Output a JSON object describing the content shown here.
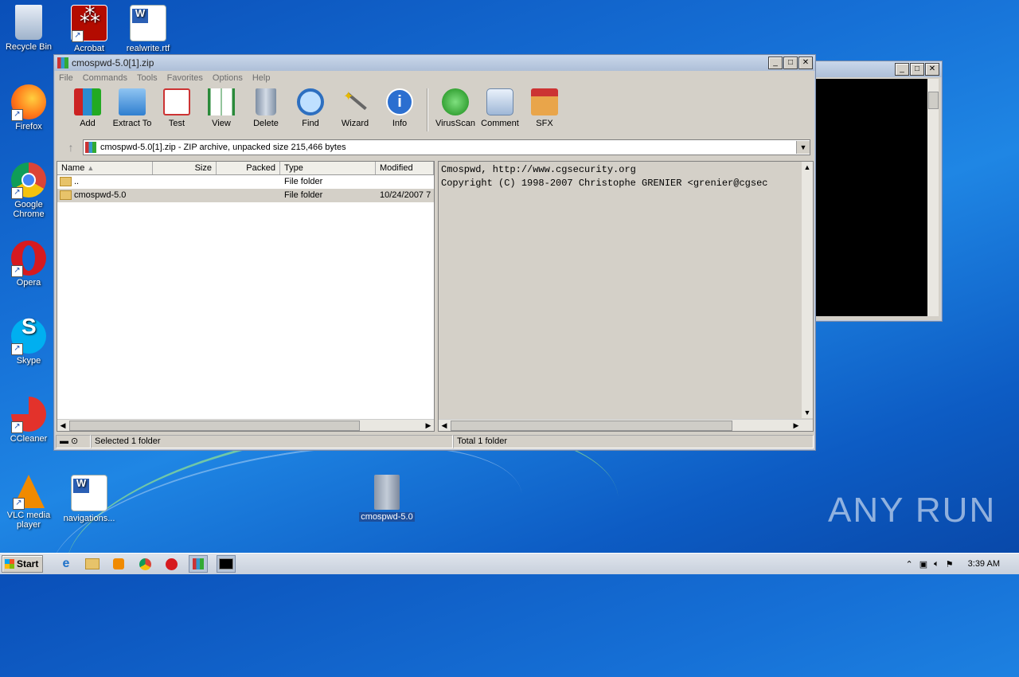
{
  "desktop": {
    "icons": [
      {
        "label": "Recycle Bin"
      },
      {
        "label": "Acrobat"
      },
      {
        "label": "realwrite.rtf"
      },
      {
        "label": "Firefox"
      },
      {
        "label": "Google Chrome"
      },
      {
        "label": "Opera"
      },
      {
        "label": "Skype"
      },
      {
        "label": "CCleaner"
      },
      {
        "label": "VLC media player"
      },
      {
        "label": "navigations..."
      },
      {
        "label": "cmospwd-5.0"
      }
    ],
    "watermark": "ANY RUN"
  },
  "winrar": {
    "title": "cmospwd-5.0[1].zip",
    "menu": [
      "File",
      "Commands",
      "Tools",
      "Favorites",
      "Options",
      "Help"
    ],
    "toolbar": [
      "Add",
      "Extract To",
      "Test",
      "View",
      "Delete",
      "Find",
      "Wizard",
      "Info",
      "VirusScan",
      "Comment",
      "SFX"
    ],
    "address": "cmospwd-5.0[1].zip - ZIP archive, unpacked size 215,466 bytes",
    "columns": [
      "Name",
      "Size",
      "Packed",
      "Type",
      "Modified"
    ],
    "rows": [
      {
        "name": "..",
        "size": "",
        "packed": "",
        "type": "File folder",
        "modified": ""
      },
      {
        "name": "cmospwd-5.0",
        "size": "",
        "packed": "",
        "type": "File folder",
        "modified": "10/24/2007 7"
      }
    ],
    "comment_lines": [
      "Cmospwd, http://www.cgsecurity.org",
      "Copyright (C) 1998-2007 Christophe GRENIER <grenier@cgsec"
    ],
    "status_left": "Selected 1 folder",
    "status_right": "Total 1 folder"
  },
  "taskbar": {
    "start": "Start",
    "clock": "3:39 AM"
  }
}
